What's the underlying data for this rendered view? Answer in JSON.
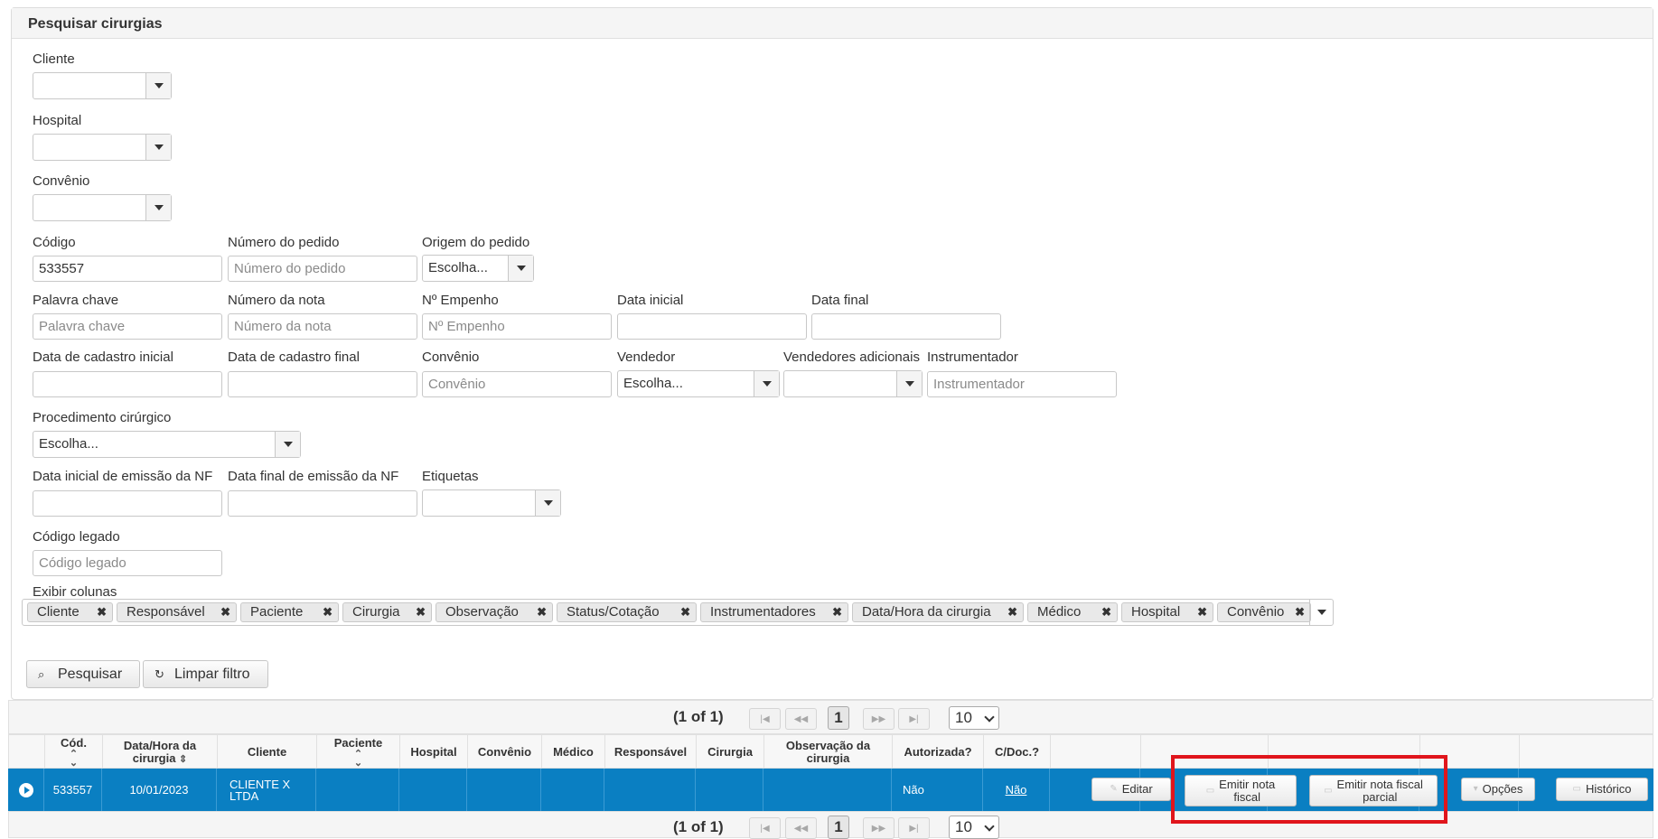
{
  "panel": {
    "title": "Pesquisar cirurgias"
  },
  "filters": {
    "cliente": {
      "label": "Cliente",
      "value": ""
    },
    "hospital": {
      "label": "Hospital",
      "value": ""
    },
    "convenio_select": {
      "label": "Convênio",
      "value": ""
    },
    "codigo": {
      "label": "Código",
      "value": "533557"
    },
    "numero_pedido": {
      "label": "Número do pedido",
      "placeholder": "Número do pedido"
    },
    "origem_pedido": {
      "label": "Origem do pedido",
      "value": "Escolha..."
    },
    "palavra_chave": {
      "label": "Palavra chave",
      "placeholder": "Palavra chave"
    },
    "numero_nota": {
      "label": "Número da nota",
      "placeholder": "Número da nota"
    },
    "empenho": {
      "label": "Nº Empenho",
      "placeholder": "Nº Empenho"
    },
    "data_inicial": {
      "label": "Data inicial"
    },
    "data_final": {
      "label": "Data final"
    },
    "data_cadastro_inicial": {
      "label": "Data de cadastro inicial"
    },
    "data_cadastro_final": {
      "label": "Data de cadastro final"
    },
    "convenio_text": {
      "label": "Convênio",
      "placeholder": "Convênio"
    },
    "vendedor": {
      "label": "Vendedor",
      "value": "Escolha..."
    },
    "vendedores_adicionais": {
      "label": "Vendedores adicionais",
      "value": ""
    },
    "instrumentador": {
      "label": "Instrumentador",
      "placeholder": "Instrumentador"
    },
    "procedimento": {
      "label": "Procedimento cirúrgico",
      "value": "Escolha..."
    },
    "data_inicial_nf": {
      "label": "Data inicial de emissão da NF"
    },
    "data_final_nf": {
      "label": "Data final de emissão da NF"
    },
    "etiquetas": {
      "label": "Etiquetas",
      "value": ""
    },
    "codigo_legado": {
      "label": "Código legado",
      "placeholder": "Código legado"
    },
    "exibir_colunas": {
      "label": "Exibir colunas",
      "chips": [
        "Cliente",
        "Responsável",
        "Paciente",
        "Cirurgia",
        "Observação",
        "Status/Cotação",
        "Instrumentadores",
        "Data/Hora da cirurgia",
        "Médico",
        "Hospital",
        "Convênio"
      ]
    }
  },
  "actions": {
    "pesquisar": "Pesquisar",
    "limpar": "Limpar filtro"
  },
  "pager": {
    "info": "(1 of 1)",
    "current_page": "1",
    "rows_per_page": "10"
  },
  "table": {
    "headers": {
      "cod": "Cód.",
      "data_hora_1": "Data/Hora da",
      "data_hora_2": "cirurgia",
      "cliente": "Cliente",
      "paciente": "Paciente",
      "hospital": "Hospital",
      "convenio": "Convênio",
      "medico": "Médico",
      "responsavel": "Responsável",
      "cirurgia": "Cirurgia",
      "observacao_1": "Observação da",
      "observacao_2": "cirurgia",
      "autorizada": "Autorizada?",
      "cdoc": "C/Doc.?"
    },
    "row": {
      "cod": "533557",
      "data_hora": "10/01/2023",
      "cliente_1": "CLIENTE X",
      "cliente_2": "LTDA",
      "autorizada": "Não",
      "cdoc": "Não",
      "buttons": {
        "editar": "Editar",
        "emitir_1": "Emitir nota",
        "emitir_2": "fiscal",
        "emitir_parcial_1": "Emitir nota fiscal",
        "emitir_parcial_2": "parcial",
        "opcoes": "Opções",
        "historico": "Histórico"
      }
    }
  },
  "colors": {
    "row_selected": "#0a7fc2",
    "highlight": "#e0151c"
  }
}
